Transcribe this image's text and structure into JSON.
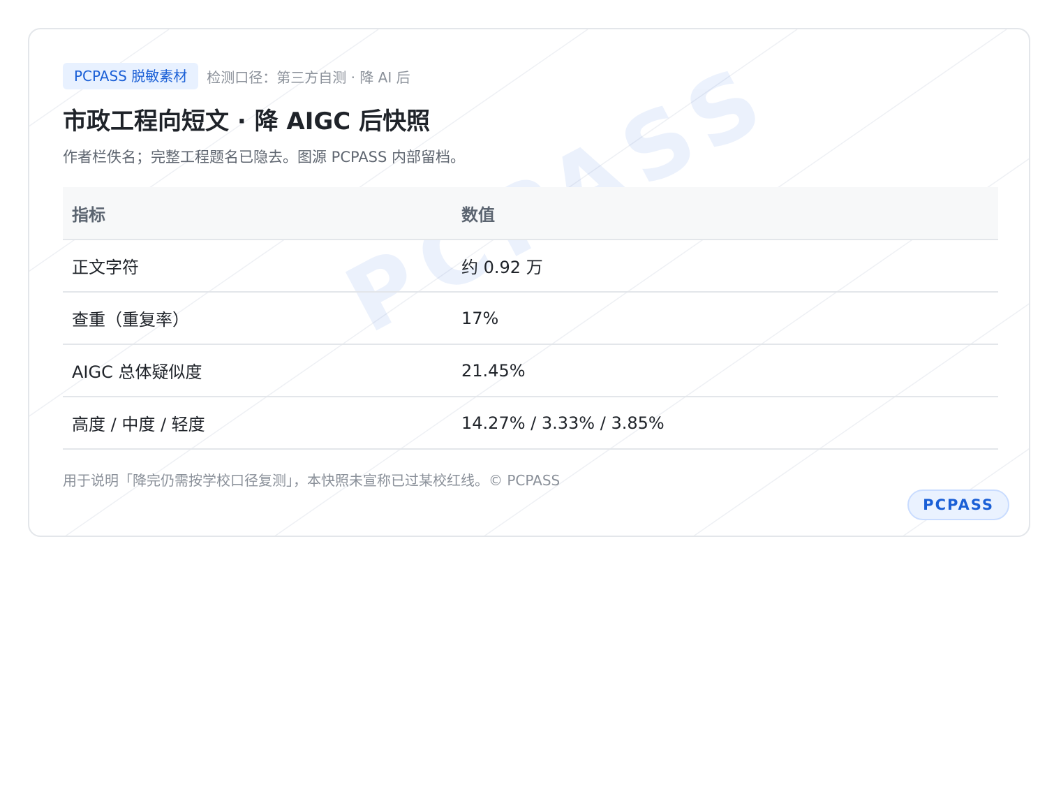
{
  "card": {
    "badge": "PCPASS 脱敏素材",
    "meta": "检测口径：第三方自测 · 降 AI 后",
    "title": "市政工程向短文 · 降 AIGC 后快照",
    "subtitle": "作者栏佚名；完整工程题名已隐去。图源 PCPASS 内部留档。",
    "watermark": "PCPASS",
    "table": {
      "headers": [
        "指标",
        "数值"
      ],
      "rows": [
        {
          "metric": "正文字符",
          "value": "约 0.92 万"
        },
        {
          "metric": "查重（重复率）",
          "value": "17%"
        },
        {
          "metric": "AIGC 总体疑似度",
          "value": "21.45%"
        },
        {
          "metric": "高度 / 中度 / 轻度",
          "value": "14.27% / 3.33% / 3.85%"
        }
      ]
    },
    "footnote": "用于说明「降完仍需按学校口径复测」，本快照未宣称已过某校红线。© PCPASS",
    "corner_badge": "PCPASS"
  },
  "colors": {
    "accent": "#1a5fd6",
    "badge_bg": "#e8f1ff",
    "border": "#e3e6ea",
    "header_bg": "#f7f8f9"
  }
}
